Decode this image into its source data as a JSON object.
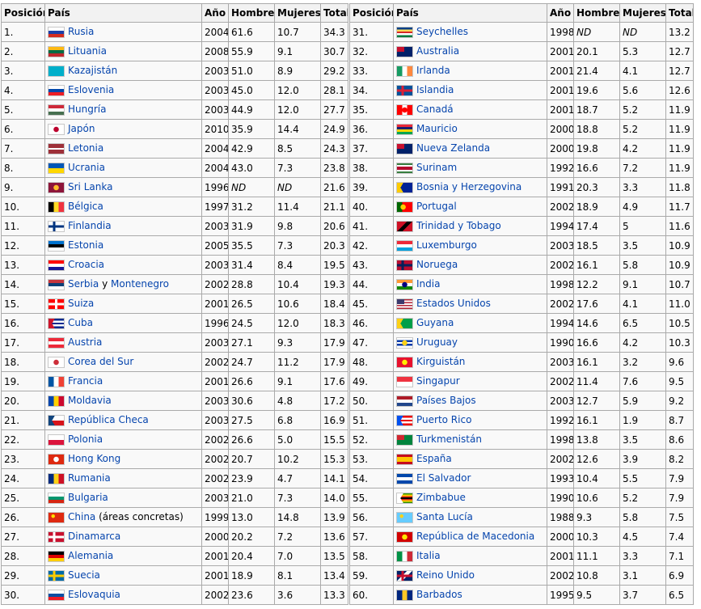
{
  "headers": {
    "pos": "Posición",
    "country": "País",
    "year": "Año",
    "men": "Hombres",
    "women": "Mujeres",
    "total": "Total"
  },
  "left": [
    {
      "pos": "1.",
      "name": "Rusia",
      "year": "2004",
      "men": "61.6",
      "women": "10.7",
      "total": "34.3",
      "flag": "russia-flag",
      "c": [
        "#ffffff",
        "#1c3fa8",
        "#d52b1e"
      ]
    },
    {
      "pos": "2.",
      "name": "Lituania",
      "year": "2008",
      "men": "55.9",
      "women": "9.1",
      "total": "30.7",
      "flag": "lithuania-flag",
      "c": [
        "#fdb913",
        "#006a44",
        "#c1272d"
      ]
    },
    {
      "pos": "3.",
      "name": "Kazajistán",
      "year": "2003",
      "men": "51.0",
      "women": "8.9",
      "total": "29.2",
      "flag": "kazakhstan-flag",
      "c": [
        "#00afca"
      ]
    },
    {
      "pos": "4.",
      "name": "Eslovenia",
      "year": "2003",
      "men": "45.0",
      "women": "12.0",
      "total": "28.1",
      "flag": "slovenia-flag",
      "c": [
        "#ffffff",
        "#0047ab",
        "#ed1c24"
      ]
    },
    {
      "pos": "5.",
      "name": "Hungría",
      "year": "2003",
      "men": "44.9",
      "women": "12.0",
      "total": "27.7",
      "flag": "hungary-flag",
      "c": [
        "#ce2939",
        "#ffffff",
        "#477050"
      ]
    },
    {
      "pos": "6.",
      "name": "Japón",
      "year": "2010",
      "men": "35.9",
      "women": "14.4",
      "total": "24.9",
      "flag": "japan-flag",
      "c": [
        "#ffffff"
      ],
      "dot": "#bc002d"
    },
    {
      "pos": "7.",
      "name": "Letonia",
      "year": "2004",
      "men": "42.9",
      "women": "8.5",
      "total": "24.3",
      "flag": "latvia-flag",
      "c": [
        "#9e3039",
        "#9e3039",
        "#ffffff",
        "#9e3039",
        "#9e3039"
      ]
    },
    {
      "pos": "8.",
      "name": "Ucrania",
      "year": "2004",
      "men": "43.0",
      "women": "7.3",
      "total": "23.8",
      "flag": "ukraine-flag",
      "c": [
        "#0057b7",
        "#ffd700"
      ]
    },
    {
      "pos": "9.",
      "name": "Sri Lanka",
      "year": "1996",
      "men": "ND",
      "women": "ND",
      "total": "21.6",
      "flag": "sri-lanka-flag",
      "c": [
        "#8d153a"
      ],
      "dot": "#ffbe29"
    },
    {
      "pos": "10.",
      "name": "Bélgica",
      "year": "1997",
      "men": "31.2",
      "women": "11.4",
      "total": "21.1",
      "flag": "belgium-flag",
      "v": [
        "#000000",
        "#fdda24",
        "#ef3340"
      ]
    },
    {
      "pos": "11.",
      "name": "Finlandia",
      "year": "2003",
      "men": "31.9",
      "women": "9.8",
      "total": "20.6",
      "flag": "finland-flag",
      "c": [
        "#ffffff"
      ],
      "cross": "#003580"
    },
    {
      "pos": "12.",
      "name": "Estonia",
      "year": "2005",
      "men": "35.5",
      "women": "7.3",
      "total": "20.3",
      "flag": "estonia-flag",
      "c": [
        "#0072ce",
        "#000000",
        "#ffffff"
      ]
    },
    {
      "pos": "13.",
      "name": "Croacia",
      "year": "2003",
      "men": "31.4",
      "women": "8.4",
      "total": "19.5",
      "flag": "croatia-flag",
      "c": [
        "#ff0000",
        "#ffffff",
        "#171796"
      ]
    },
    {
      "pos": "14.",
      "name": "Serbia",
      "name2": "Montenegro",
      "mid": "y",
      "year": "2002",
      "men": "28.8",
      "women": "10.4",
      "total": "19.3",
      "flag": "serbia-flag",
      "c": [
        "#c6363c",
        "#0c4076",
        "#ffffff"
      ]
    },
    {
      "pos": "15.",
      "name": "Suiza",
      "year": "2001",
      "men": "26.5",
      "women": "10.6",
      "total": "18.4",
      "flag": "switzerland-flag",
      "c": [
        "#ff0000"
      ],
      "cross": "#ffffff",
      "centered": true
    },
    {
      "pos": "16.",
      "name": "Cuba",
      "year": "1996",
      "men": "24.5",
      "women": "12.0",
      "total": "18.3",
      "flag": "cuba-flag",
      "c": [
        "#002a8f",
        "#ffffff",
        "#002a8f",
        "#ffffff",
        "#002a8f"
      ],
      "tri": "#cf142b"
    },
    {
      "pos": "17.",
      "name": "Austria",
      "year": "2003",
      "men": "27.1",
      "women": "9.3",
      "total": "17.9",
      "flag": "austria-flag",
      "c": [
        "#ed2939",
        "#ffffff",
        "#ed2939"
      ]
    },
    {
      "pos": "18.",
      "name": "Corea del Sur",
      "year": "2002",
      "men": "24.7",
      "women": "11.2",
      "total": "17.9",
      "flag": "south-korea-flag",
      "c": [
        "#ffffff"
      ],
      "dot": "#cd2e3a"
    },
    {
      "pos": "19.",
      "name": "Francia",
      "year": "2001",
      "men": "26.6",
      "women": "9.1",
      "total": "17.6",
      "flag": "france-flag",
      "v": [
        "#0055a4",
        "#ffffff",
        "#ef4135"
      ]
    },
    {
      "pos": "20.",
      "name": "Moldavia",
      "year": "2003",
      "men": "30.6",
      "women": "4.8",
      "total": "17.2",
      "flag": "moldova-flag",
      "v": [
        "#0046ae",
        "#ffd200",
        "#cc092f"
      ]
    },
    {
      "pos": "21.",
      "name": "República Checa",
      "year": "2003",
      "men": "27.5",
      "women": "6.8",
      "total": "16.9",
      "flag": "czech-flag",
      "c": [
        "#ffffff",
        "#d7141a"
      ],
      "tri": "#11457e"
    },
    {
      "pos": "22.",
      "name": "Polonia",
      "year": "2002",
      "men": "26.6",
      "women": "5.0",
      "total": "15.5",
      "flag": "poland-flag",
      "c": [
        "#ffffff",
        "#dc143c"
      ]
    },
    {
      "pos": "23.",
      "name": "Hong Kong",
      "year": "2002",
      "men": "20.7",
      "women": "10.2",
      "total": "15.3",
      "flag": "hong-kong-flag",
      "c": [
        "#de2910"
      ],
      "dot": "#ffffff"
    },
    {
      "pos": "24.",
      "name": "Rumania",
      "year": "2002",
      "men": "23.9",
      "women": "4.7",
      "total": "14.1",
      "flag": "romania-flag",
      "v": [
        "#002b7f",
        "#fcd116",
        "#ce1126"
      ]
    },
    {
      "pos": "25.",
      "name": "Bulgaria",
      "year": "2003",
      "men": "21.0",
      "women": "7.3",
      "total": "14.0",
      "flag": "bulgaria-flag",
      "c": [
        "#ffffff",
        "#00966e",
        "#d62612"
      ]
    },
    {
      "pos": "26.",
      "name": "China",
      "extra": " (áreas concretas)",
      "year": "1999",
      "men": "13.0",
      "women": "14.8",
      "total": "13.9",
      "flag": "china-flag",
      "c": [
        "#de2910"
      ],
      "star": "#ffde00"
    },
    {
      "pos": "27.",
      "name": "Dinamarca",
      "year": "2000",
      "men": "20.2",
      "women": "7.2",
      "total": "13.6",
      "flag": "denmark-flag",
      "c": [
        "#c8102e"
      ],
      "cross": "#ffffff"
    },
    {
      "pos": "28.",
      "name": "Alemania",
      "year": "2001",
      "men": "20.4",
      "women": "7.0",
      "total": "13.5",
      "flag": "germany-flag",
      "c": [
        "#000000",
        "#dd0000",
        "#ffce00"
      ]
    },
    {
      "pos": "29.",
      "name": "Suecia",
      "year": "2001",
      "men": "18.9",
      "women": "8.1",
      "total": "13.4",
      "flag": "sweden-flag",
      "c": [
        "#006aa7"
      ],
      "cross": "#fecc00"
    },
    {
      "pos": "30.",
      "name": "Eslovaquia",
      "year": "2002",
      "men": "23.6",
      "women": "3.6",
      "total": "13.3",
      "flag": "slovakia-flag",
      "c": [
        "#ffffff",
        "#0b4ea2",
        "#ee1c25"
      ]
    }
  ],
  "right": [
    {
      "pos": "31.",
      "name": "Seychelles",
      "year": "1998",
      "men": "ND",
      "women": "ND",
      "total": "13.2",
      "flag": "seychelles-flag",
      "c": [
        "#003f87",
        "#fcd856",
        "#d62828",
        "#ffffff",
        "#007a3d"
      ]
    },
    {
      "pos": "32.",
      "name": "Australia",
      "year": "2001",
      "men": "20.1",
      "women": "5.3",
      "total": "12.7",
      "flag": "australia-flag",
      "c": [
        "#012169"
      ],
      "canton": "#c8102e"
    },
    {
      "pos": "33.",
      "name": "Irlanda",
      "year": "2001",
      "men": "21.4",
      "women": "4.1",
      "total": "12.7",
      "flag": "ireland-flag",
      "v": [
        "#169b62",
        "#ffffff",
        "#ff883e"
      ]
    },
    {
      "pos": "34.",
      "name": "Islandia",
      "year": "2001",
      "men": "19.6",
      "women": "5.6",
      "total": "12.6",
      "flag": "iceland-flag",
      "c": [
        "#02529c"
      ],
      "cross": "#dc1e35"
    },
    {
      "pos": "35.",
      "name": "Canadá",
      "year": "2001",
      "men": "18.7",
      "women": "5.2",
      "total": "11.9",
      "flag": "canada-flag",
      "v": [
        "#ff0000",
        "#ffffff",
        "#ff0000"
      ],
      "dot": "#ff0000"
    },
    {
      "pos": "36.",
      "name": "Mauricio",
      "year": "2000",
      "men": "18.8",
      "women": "5.2",
      "total": "11.9",
      "flag": "mauritius-flag",
      "c": [
        "#ea2839",
        "#1a206d",
        "#ffd500",
        "#00a551"
      ]
    },
    {
      "pos": "37.",
      "name": "Nueva Zelanda",
      "year": "2000",
      "men": "19.8",
      "women": "4.2",
      "total": "11.9",
      "flag": "new-zealand-flag",
      "c": [
        "#012169"
      ],
      "canton": "#c8102e"
    },
    {
      "pos": "38.",
      "name": "Surinam",
      "year": "1992",
      "men": "16.6",
      "women": "7.2",
      "total": "11.9",
      "flag": "suriname-flag",
      "c": [
        "#377e3f",
        "#ffffff",
        "#b40a2d",
        "#b40a2d",
        "#ffffff",
        "#377e3f"
      ]
    },
    {
      "pos": "39.",
      "name": "Bosnia y Herzegovina",
      "year": "1991",
      "men": "20.3",
      "women": "3.3",
      "total": "11.8",
      "flag": "bosnia-flag",
      "c": [
        "#002395"
      ],
      "tri": "#fecb00"
    },
    {
      "pos": "40.",
      "name": "Portugal",
      "year": "2002",
      "men": "18.9",
      "women": "4.9",
      "total": "11.7",
      "flag": "portugal-flag",
      "v": [
        "#006600",
        "#ff0000",
        "#ff0000"
      ],
      "dot": "#ffcc00"
    },
    {
      "pos": "41.",
      "name": "Trinidad y Tobago",
      "year": "1994",
      "men": "17.4",
      "women": "5",
      "total": "11.6",
      "flag": "trinidad-flag",
      "c": [
        "#ce1126"
      ],
      "diag": "#000000"
    },
    {
      "pos": "42.",
      "name": "Luxemburgo",
      "year": "2003",
      "men": "18.5",
      "women": "3.5",
      "total": "10.9",
      "flag": "luxembourg-flag",
      "c": [
        "#ed2939",
        "#ffffff",
        "#00a1de"
      ]
    },
    {
      "pos": "43.",
      "name": "Noruega",
      "year": "2002",
      "men": "16.1",
      "women": "5.8",
      "total": "10.9",
      "flag": "norway-flag",
      "c": [
        "#ba0c2f"
      ],
      "cross": "#00205b"
    },
    {
      "pos": "44.",
      "name": "India",
      "year": "1998",
      "men": "12.2",
      "women": "9.1",
      "total": "10.7",
      "flag": "india-flag",
      "c": [
        "#ff9933",
        "#ffffff",
        "#138808"
      ],
      "dot": "#000080",
      "centered": true
    },
    {
      "pos": "45.",
      "name": "Estados Unidos",
      "year": "2002",
      "men": "17.6",
      "women": "4.1",
      "total": "11.0",
      "flag": "usa-flag",
      "c": [
        "#b22234",
        "#ffffff",
        "#b22234",
        "#ffffff",
        "#b22234",
        "#ffffff",
        "#b22234"
      ],
      "canton": "#3c3b6e"
    },
    {
      "pos": "46.",
      "name": "Guyana",
      "year": "1994",
      "men": "14.6",
      "women": "6.5",
      "total": "10.5",
      "flag": "guyana-flag",
      "c": [
        "#009e49"
      ],
      "tri": "#fcd116"
    },
    {
      "pos": "47.",
      "name": "Uruguay",
      "year": "1990",
      "men": "16.6",
      "women": "4.2",
      "total": "10.3",
      "flag": "uruguay-flag",
      "c": [
        "#ffffff",
        "#0038a8",
        "#ffffff",
        "#0038a8",
        "#ffffff"
      ],
      "dot": "#fcd116"
    },
    {
      "pos": "48.",
      "name": "Kirguistán",
      "year": "2003",
      "men": "16.1",
      "women": "3.2",
      "total": "9.6",
      "flag": "kyrgyzstan-flag",
      "c": [
        "#e8112d"
      ],
      "dot": "#ffef00",
      "centered": true
    },
    {
      "pos": "49.",
      "name": "Singapur",
      "year": "2002",
      "men": "11.4",
      "women": "7.6",
      "total": "9.5",
      "flag": "singapore-flag",
      "c": [
        "#ef3340",
        "#ffffff"
      ]
    },
    {
      "pos": "50.",
      "name": "Países Bajos",
      "year": "2003",
      "men": "12.7",
      "women": "5.9",
      "total": "9.2",
      "flag": "netherlands-flag",
      "c": [
        "#ae1c28",
        "#ffffff",
        "#21468b"
      ]
    },
    {
      "pos": "51.",
      "name": "Puerto Rico",
      "year": "1992",
      "men": "16.1",
      "women": "1.9",
      "total": "8.7",
      "flag": "puerto-rico-flag",
      "c": [
        "#ed0000",
        "#ffffff",
        "#ed0000",
        "#ffffff",
        "#ed0000"
      ],
      "tri": "#0050f0"
    },
    {
      "pos": "52.",
      "name": "Turkmenistán",
      "year": "1998",
      "men": "13.8",
      "women": "3.5",
      "total": "8.6",
      "flag": "turkmenistan-flag",
      "c": [
        "#00843d"
      ],
      "canton": "#d22630"
    },
    {
      "pos": "53.",
      "name": "España",
      "year": "2002",
      "men": "12.6",
      "women": "3.9",
      "total": "8.2",
      "flag": "spain-flag",
      "c": [
        "#c60b1e",
        "#ffc400",
        "#ffc400",
        "#c60b1e"
      ]
    },
    {
      "pos": "54.",
      "name": "El Salvador",
      "year": "1993",
      "men": "10.4",
      "women": "5.5",
      "total": "7.9",
      "flag": "el-salvador-flag",
      "c": [
        "#0047ab",
        "#ffffff",
        "#0047ab"
      ]
    },
    {
      "pos": "55.",
      "name": "Zimbabue",
      "year": "1990",
      "men": "10.6",
      "women": "5.2",
      "total": "7.9",
      "flag": "zimbabwe-flag",
      "c": [
        "#319208",
        "#ffd200",
        "#de2010",
        "#000000",
        "#de2010",
        "#ffd200",
        "#319208"
      ],
      "tri": "#ffffff"
    },
    {
      "pos": "56.",
      "name": "Santa Lucía",
      "year": "1988",
      "men": "9.3",
      "women": "5.8",
      "total": "7.5",
      "flag": "saint-lucia-flag",
      "c": [
        "#66ccff"
      ],
      "star": "#fcd116"
    },
    {
      "pos": "57.",
      "name": "República de Macedonia",
      "year": "2000",
      "men": "10.3",
      "women": "4.5",
      "total": "7.4",
      "flag": "macedonia-flag",
      "c": [
        "#d20000"
      ],
      "dot": "#ffe600",
      "centered": true
    },
    {
      "pos": "58.",
      "name": "Italia",
      "year": "2001",
      "men": "11.1",
      "women": "3.3",
      "total": "7.1",
      "flag": "italy-flag",
      "v": [
        "#009246",
        "#ffffff",
        "#ce2b37"
      ]
    },
    {
      "pos": "59.",
      "name": "Reino Unido",
      "year": "2002",
      "men": "10.8",
      "women": "3.1",
      "total": "6.9",
      "flag": "uk-flag",
      "c": [
        "#012169"
      ],
      "cross": "#c8102e",
      "diag": "#ffffff"
    },
    {
      "pos": "60.",
      "name": "Barbados",
      "year": "1995",
      "men": "9.5",
      "women": "3.7",
      "total": "6.5",
      "flag": "barbados-flag",
      "v": [
        "#00267f",
        "#ffc726",
        "#00267f"
      ]
    }
  ]
}
